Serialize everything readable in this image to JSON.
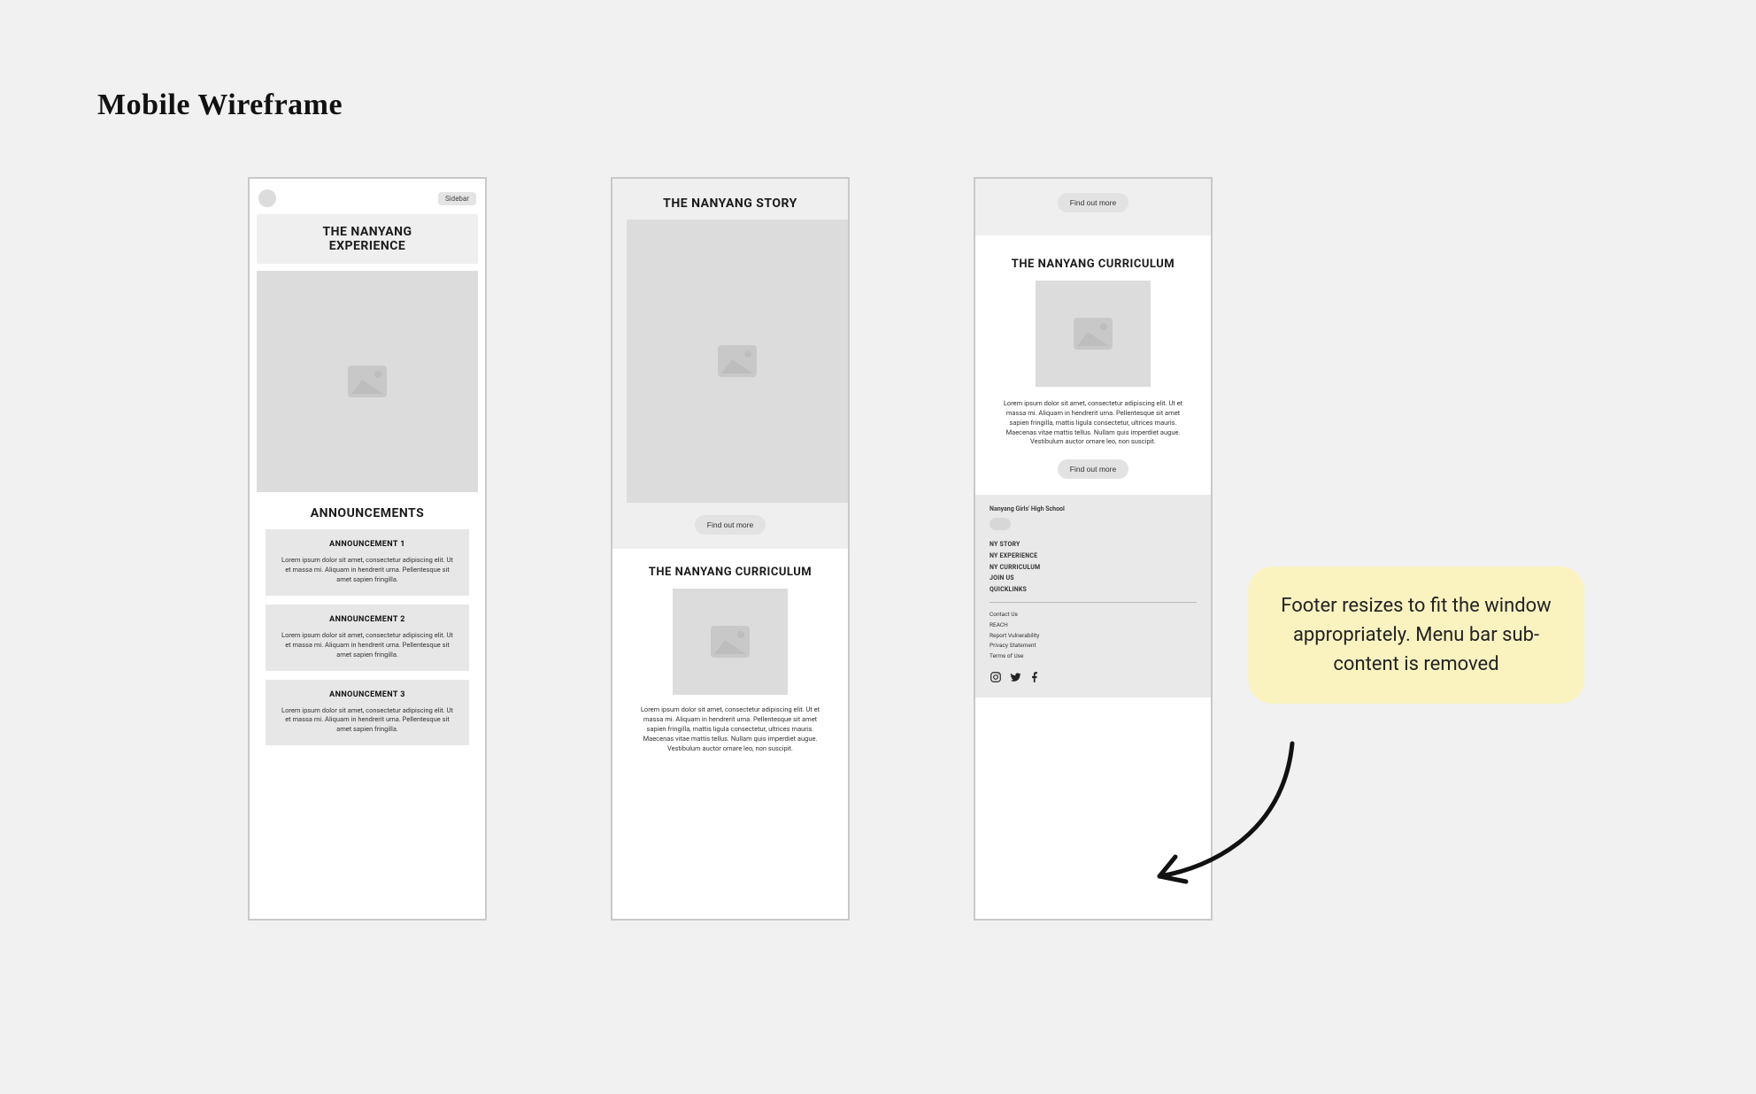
{
  "page": {
    "title": "Mobile Wireframe"
  },
  "common": {
    "sidebar_chip": "Sidebar",
    "find_out_more": "Find out more",
    "lorem_short": "Lorem ipsum dolor sit amet, consectetur adipiscing elit. Ut et massa mi. Aliquam in hendrerit urna. Pellentesque sit amet sapien fringilla.",
    "lorem_long": "Lorem ipsum dolor sit amet, consectetur adipiscing elit. Ut et massa mi. Aliquam in hendrerit urna. Pellentesque sit amet sapien fringilla, mattis ligula consectetur, ultrices mauris. Maecenas vitae mattis tellus. Nullam quis imperdiet augue. Vestibulum auctor ornare leo, non suscipit."
  },
  "frame1": {
    "hero_title_line1": "THE NANYANG",
    "hero_title_line2": "EXPERIENCE",
    "announcements_title": "ANNOUNCEMENTS",
    "cards": [
      {
        "title": "ANNOUNCEMENT 1"
      },
      {
        "title": "ANNOUNCEMENT 2"
      },
      {
        "title": "ANNOUNCEMENT 3"
      }
    ]
  },
  "frame2": {
    "story_title": "THE NANYANG STORY",
    "curriculum_title": "THE NANYANG CURRICULUM"
  },
  "frame3": {
    "curriculum_title": "THE NANYANG CURRICULUM",
    "footer": {
      "school": "Nanyang Girls' High School",
      "primary": [
        "NY STORY",
        "NY EXPERIENCE",
        "NY CURRICULUM",
        "JOIN US",
        "QUICKLINKS"
      ],
      "secondary": [
        "Contact Us",
        "REACH",
        "Report Vulnerability",
        "Privacy Statement",
        "Terms of Use"
      ]
    }
  },
  "annotation": {
    "text": "Footer resizes to fit the window appropriately. Menu bar sub-content is removed"
  }
}
